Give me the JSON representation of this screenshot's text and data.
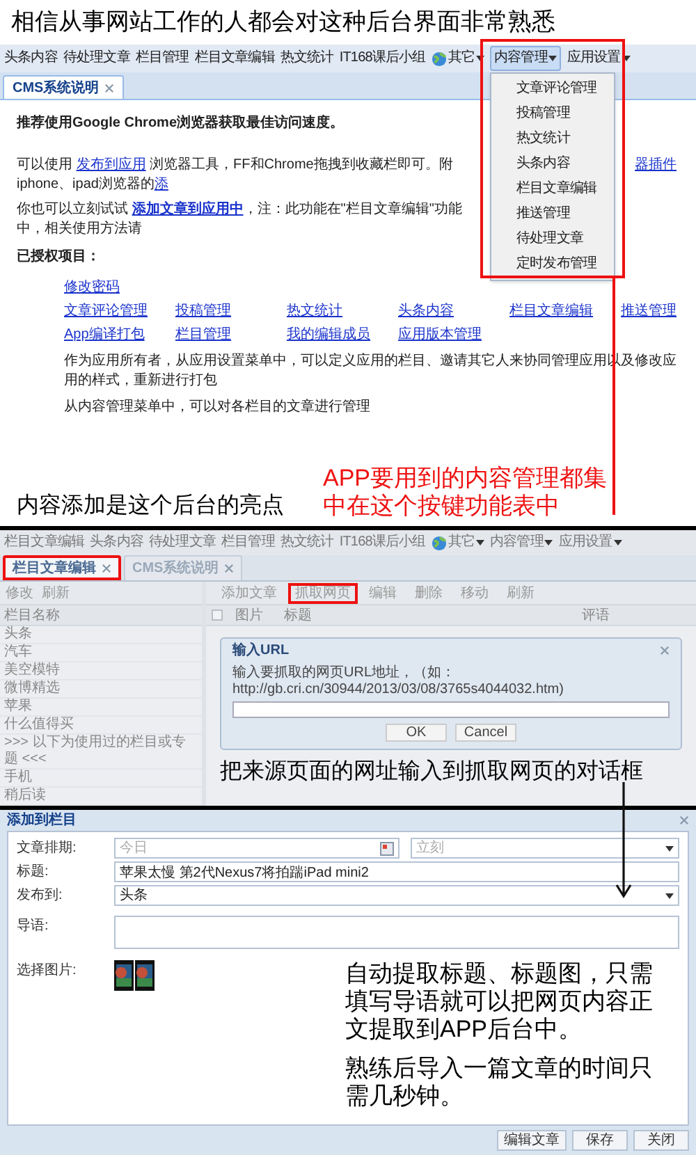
{
  "caption": "相信从事网站工作的人都会对这种后台界面非常熟悉",
  "screen1": {
    "nav": [
      {
        "label": "头条内容",
        "kind": "link",
        "open": false
      },
      {
        "label": "待处理文章",
        "kind": "link",
        "open": false
      },
      {
        "label": "栏目管理",
        "kind": "link",
        "open": false
      },
      {
        "label": "栏目文章编辑",
        "kind": "link",
        "open": false
      },
      {
        "label": "热文统计",
        "kind": "link",
        "open": false
      },
      {
        "label": "IT168课后小组",
        "kind": "link",
        "open": false
      },
      {
        "label": "其它",
        "kind": "globe_menu",
        "open": false
      },
      {
        "label": "内容管理",
        "kind": "menu",
        "open": true
      },
      {
        "label": "应用设置",
        "kind": "menu",
        "open": false
      }
    ],
    "menu": {
      "highlighted": true,
      "items": [
        "文章评论管理",
        "投稿管理",
        "热文统计",
        "头条内容",
        "栏目文章编辑",
        "推送管理",
        "待处理文章",
        "定时发布管理"
      ]
    },
    "tabs": [
      {
        "label": "CMS系统说明",
        "selected": true
      }
    ],
    "notice": "推荐使用Google Chrome浏览器获取最佳访问速度。",
    "lines": [
      {
        "segments": [
          {
            "kind": "text",
            "text": "可以使用 "
          },
          {
            "kind": "link",
            "text": "发布到应用"
          },
          {
            "kind": "text",
            "text": " 浏览器工具，FF和Chrome拖拽到收藏栏即可。附iphone、ipad浏览器的"
          },
          {
            "kind": "link",
            "text": "添"
          }
        ],
        "right_link": "器插件"
      },
      {
        "segments": [
          {
            "kind": "text",
            "text": "你也可以立刻试试 "
          },
          {
            "kind": "strong_link",
            "text": "添加文章到应用中"
          },
          {
            "kind": "text",
            "text": "，注：此功能在\"栏目文章编辑\"功能中，相关使用方法请"
          }
        ]
      }
    ],
    "authorized_heading": "已授权项目：",
    "single_link": "修改密码",
    "link_rows": [
      [
        "文章评论管理",
        "投稿管理",
        "热文统计",
        "头条内容",
        "栏目文章编辑",
        "推送管理"
      ],
      [
        "App编译打包",
        "栏目管理",
        "我的编辑成员",
        "应用版本管理"
      ]
    ],
    "notes": [
      "作为应用所有者，从应用设置菜单中，可以定义应用的栏目、邀请其它人来协同管理应用以及修改应用的样式，重新进行打包",
      "从内容管理菜单中，可以对各栏目的文章进行管理"
    ],
    "note_left": "内容添加是这个后台的亮点",
    "note_red": "APP要用到的内容管理都集中在这个按键功能表中"
  },
  "screen2": {
    "nav": [
      {
        "label": "栏目文章编辑",
        "kind": "link",
        "open": false
      },
      {
        "label": "头条内容",
        "kind": "link",
        "open": false
      },
      {
        "label": "待处理文章",
        "kind": "link",
        "open": false
      },
      {
        "label": "栏目管理",
        "kind": "link",
        "open": false
      },
      {
        "label": "热文统计",
        "kind": "link",
        "open": false
      },
      {
        "label": "IT168课后小组",
        "kind": "link",
        "open": false
      },
      {
        "label": "其它",
        "kind": "globe_menu",
        "open": false
      },
      {
        "label": "内容管理",
        "kind": "menu",
        "open": false
      },
      {
        "label": "应用设置",
        "kind": "menu",
        "open": false
      }
    ],
    "tabs": [
      {
        "label": "栏目文章编辑",
        "selected": true,
        "highlighted": true
      },
      {
        "label": "CMS系统说明",
        "selected": false,
        "highlighted": false
      }
    ],
    "left_toolbar": [
      "修改",
      "刷新"
    ],
    "left_header": "栏目名称",
    "categories": [
      "头条",
      "汽车",
      "美空模特",
      "微博精选",
      "苹果",
      "什么值得买",
      ">>> 以下为使用过的栏目或专题 <<<",
      "手机",
      "稍后读"
    ],
    "right_toolbar": [
      {
        "label": "添加文章",
        "highlighted": false
      },
      {
        "label": "抓取网页",
        "highlighted": true
      },
      {
        "label": "编辑",
        "highlighted": false
      },
      {
        "label": "删除",
        "highlighted": false
      },
      {
        "label": "移动",
        "highlighted": false
      },
      {
        "label": "刷新",
        "highlighted": false
      }
    ],
    "select_all_checked": false,
    "columns": [
      "图片",
      "标题",
      "评语"
    ],
    "dialog": {
      "title": "输入URL",
      "label": "输入要抓取的网页URL地址，（如：http://gb.cri.cn/30944/2013/03/08/3765s4044032.htm)",
      "buttons": [
        "OK",
        "Cancel"
      ]
    },
    "note": "把来源页面的网址输入到抓取网页的对话框"
  },
  "screen3": {
    "title": "添加到栏目",
    "fields": [
      {
        "kind": "schedule",
        "label": "文章排期:",
        "placeholder": "今日",
        "select_placeholder": "立刻"
      },
      {
        "kind": "text",
        "label": "标题:",
        "value": "苹果太慢 第2代Nexus7将拍踹iPad mini2"
      },
      {
        "kind": "select",
        "label": "发布到:",
        "value": "头条"
      },
      {
        "kind": "textarea",
        "label": "导语:"
      }
    ],
    "image_label": "选择图片:",
    "images": [
      {
        "kind": "picture"
      },
      {
        "kind": "picture"
      }
    ],
    "notes": [
      "自动提取标题、标题图，只需填写导语就可以把网页内容正文提取到APP后台中。",
      "熟练后导入一篇文章的时间只需几秒钟。"
    ],
    "buttons": [
      "编辑文章",
      "保存",
      "关闭"
    ]
  }
}
